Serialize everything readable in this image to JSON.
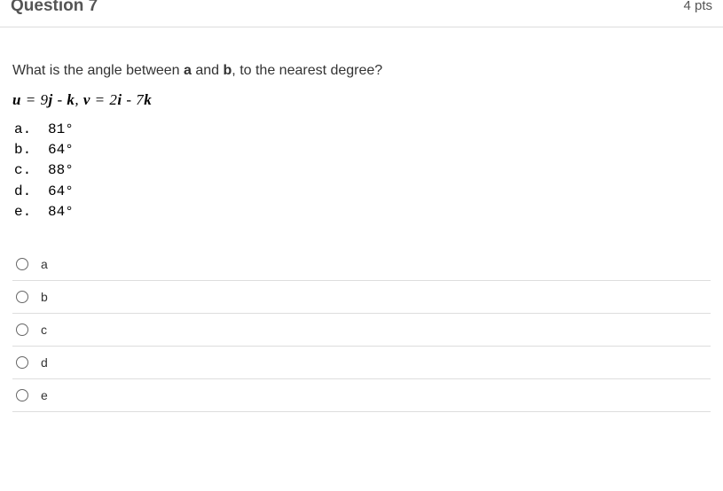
{
  "header": {
    "title": "Question 7",
    "points": "4 pts"
  },
  "question": {
    "prompt_pre": "What is the angle between ",
    "prompt_a": "a",
    "prompt_mid": " and ",
    "prompt_b": "b",
    "prompt_post": ", to the nearest degree?",
    "equation_parts": {
      "u": "u",
      "eq1": " = 9",
      "j": "j",
      "minus1": " - ",
      "k": "k",
      "comma": ",  ",
      "v": "v",
      "eq2": " = 2",
      "i": "i",
      "minus2": "  - 7",
      "k2": "k"
    }
  },
  "answer_values": [
    {
      "letter": "a.",
      "value": "81°"
    },
    {
      "letter": "b.",
      "value": "64°"
    },
    {
      "letter": "c.",
      "value": "88°"
    },
    {
      "letter": "d.",
      "value": "64°"
    },
    {
      "letter": "e.",
      "value": "84°"
    }
  ],
  "options": [
    {
      "label": "a"
    },
    {
      "label": "b"
    },
    {
      "label": "c"
    },
    {
      "label": "d"
    },
    {
      "label": "e"
    }
  ]
}
